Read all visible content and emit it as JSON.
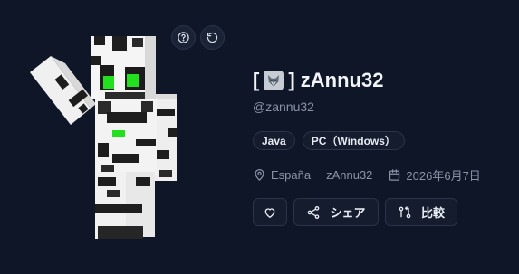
{
  "viewer": {
    "help_icon": "question-circle-icon",
    "reset_icon": "rotate-ccw-icon"
  },
  "profile": {
    "name_prefix": "[",
    "name_suffix": "] zAnnu32",
    "badge_icon": "wolf-icon",
    "handle": "@zannu32"
  },
  "tags": [
    "Java",
    "PC（Windows）"
  ],
  "meta": {
    "location": "España",
    "username": "zAnnu32",
    "date": "2026年6月7日"
  },
  "actions": {
    "like_icon": "heart-icon",
    "share_label": "シェア",
    "compare_label": "比較"
  },
  "colors": {
    "background": "#0f1628",
    "eye_green": "#23e01f",
    "skin_white": "#f1f1f1",
    "skin_dark": "#1c1c1c"
  }
}
